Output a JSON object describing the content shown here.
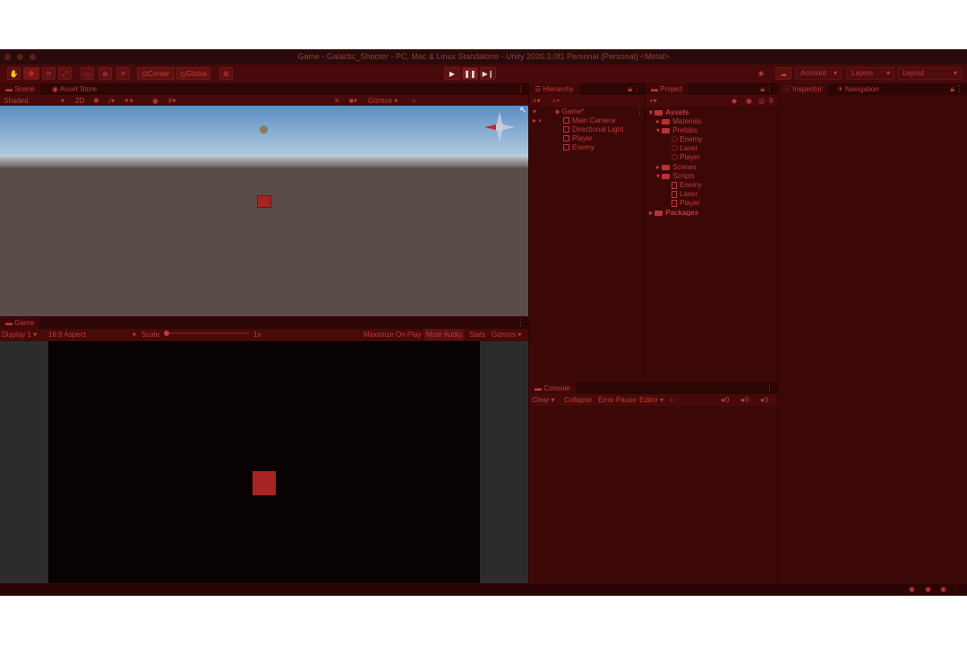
{
  "window": {
    "title": "Game - Galactic_Shooter - PC, Mac & Linux Standalone - Unity 2020.3.0f1 Personal (Personal) <Metal>"
  },
  "toolbar": {
    "pivot_label": "Center",
    "space_label": "Global",
    "account_label": "Account",
    "layers_label": "Layers",
    "layout_label": "Layout"
  },
  "scene_panel": {
    "tabs": [
      "Scene",
      "Asset Store"
    ],
    "shading_mode": "Shaded",
    "mode_2d": "2D",
    "gizmos_label": "Gizmos"
  },
  "game_panel": {
    "tab": "Game",
    "display": "Display 1",
    "aspect": "16:9 Aspect",
    "scale_label": "Scale",
    "scale_value": "1x",
    "maximize_label": "Maximize On Play",
    "mute_label": "Mute Audio",
    "stats_label": "Stats",
    "gizmos_label": "Gizmos"
  },
  "hierarchy": {
    "tab": "Hierarchy",
    "scene_name": "Game*",
    "items": [
      "Main Camera",
      "Directional Light",
      "Player",
      "Enemy"
    ]
  },
  "project": {
    "tab": "Project",
    "assets_label": "Assets",
    "tree": [
      {
        "label": "Materials",
        "level": 1
      },
      {
        "label": "Prefabs",
        "level": 1
      },
      {
        "label": "Enemy",
        "level": 2
      },
      {
        "label": "Laser",
        "level": 2
      },
      {
        "label": "Player",
        "level": 2
      },
      {
        "label": "Scenes",
        "level": 1
      },
      {
        "label": "Scripts",
        "level": 1
      },
      {
        "label": "Enemy",
        "level": 2
      },
      {
        "label": "Laser",
        "level": 2
      },
      {
        "label": "Player",
        "level": 2
      }
    ],
    "packages_label": "Packages",
    "asset_count": "9"
  },
  "console": {
    "tab": "Console",
    "clear_label": "Clear",
    "collapse_label": "Collapse",
    "error_pause_label": "Error Pause",
    "editor_label": "Editor",
    "counts": [
      "0",
      "0",
      "0"
    ]
  },
  "inspector": {
    "tabs": [
      "Inspector",
      "Navigation"
    ]
  },
  "colors": {
    "accent": "#c23a3a",
    "background": "#3c0707",
    "cube": "#b02a2a"
  }
}
